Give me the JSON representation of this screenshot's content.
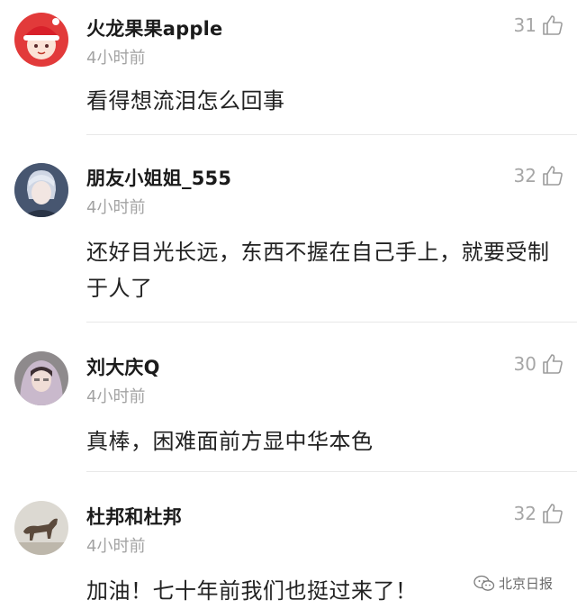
{
  "comments": [
    {
      "username": "火龙果果apple",
      "time": "4小时前",
      "likes": "31",
      "avatar_icon": "girl-santa-avatar-icon",
      "text": "看得想流泪怎么回事"
    },
    {
      "username": "朋友小姐姐_555",
      "time": "4小时前",
      "likes": "32",
      "avatar_icon": "anime-boy-avatar-icon",
      "text": "还好目光长远，东西不握在自己手上，就要受制于人了"
    },
    {
      "username": "刘大庆Q",
      "time": "4小时前",
      "likes": "30",
      "avatar_icon": "girl-hood-avatar-icon",
      "text": "真棒，困难面前方显中华本色"
    },
    {
      "username": "杜邦和杜邦",
      "time": "4小时前",
      "likes": "32",
      "avatar_icon": "bronze-horse-avatar-icon",
      "text": "加油！七十年前我们也挺过来了！"
    }
  ],
  "like_icon": "thumbs-up-icon",
  "watermark": {
    "text": "北京日报",
    "icon": "wechat-icon"
  },
  "colors": {
    "text": "#222222",
    "muted": "#a3a3a3",
    "divider": "#e8e8e8"
  }
}
